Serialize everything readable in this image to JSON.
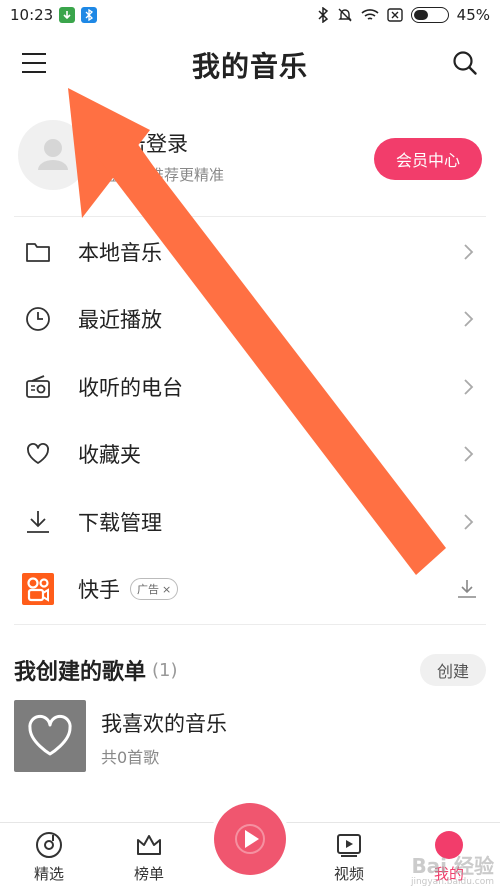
{
  "status_bar": {
    "time": "10:23",
    "battery_text": "45%",
    "battery_level": 0.45
  },
  "header": {
    "title": "我的音乐"
  },
  "login": {
    "title": "点击登录",
    "subtitle": "登录后推荐更精准",
    "vip_button": "会员中心"
  },
  "menu": {
    "items": [
      {
        "label": "本地音乐",
        "icon": "folder-icon"
      },
      {
        "label": "最近播放",
        "icon": "clock-icon"
      },
      {
        "label": "收听的电台",
        "icon": "radio-icon"
      },
      {
        "label": "收藏夹",
        "icon": "heart-icon"
      },
      {
        "label": "下载管理",
        "icon": "download-icon"
      }
    ],
    "ad": {
      "label": "快手",
      "tag": "广告",
      "tag_close": "×",
      "icon": "kuaishou-icon"
    }
  },
  "playlists": {
    "title": "我创建的歌单",
    "count": "(1)",
    "create_button": "创建",
    "items": [
      {
        "name": "我喜欢的音乐",
        "subtitle": "共0首歌"
      }
    ]
  },
  "tabbar": {
    "tabs": [
      {
        "label": "精选"
      },
      {
        "label": "榜单"
      },
      {
        "label": "视频"
      },
      {
        "label": "我的"
      }
    ]
  },
  "watermark": {
    "text": "Bai 经验",
    "sub": "jingyan.baidu.com"
  },
  "colors": {
    "accent": "#f23d6b",
    "arrow": "#ff7043"
  }
}
